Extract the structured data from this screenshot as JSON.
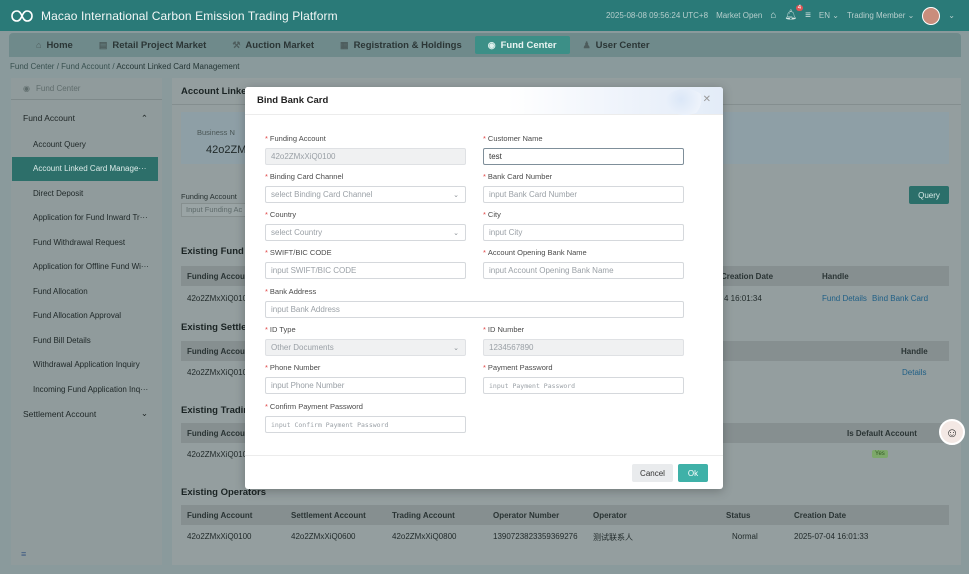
{
  "header": {
    "app_title": "Macao International Carbon Emission Trading Platform",
    "datetime": "2025-08-08 09:56:24 UTC+8",
    "market_status": "Market Open",
    "notif_count": "4",
    "language": "EN",
    "member_type": "Trading Member"
  },
  "nav": {
    "tabs": [
      {
        "label": "Home"
      },
      {
        "label": "Retail Project Market"
      },
      {
        "label": "Auction Market"
      },
      {
        "label": "Registration & Holdings"
      },
      {
        "label": "Fund Center"
      },
      {
        "label": "User Center"
      }
    ]
  },
  "breadcrumb": {
    "items": [
      "Fund Center",
      "Fund Account",
      "Account Linked Card Management"
    ],
    "sep": "/"
  },
  "sidebar": {
    "header": "Fund Center",
    "group_fund": "Fund Account",
    "items": [
      "Account Query",
      "Account Linked Card Manage···",
      "Direct Deposit",
      "Application for Fund Inward Tr···",
      "Fund Withdrawal Request",
      "Application for Offline Fund Wi···",
      "Fund Allocation",
      "Fund Allocation Approval",
      "Fund Bill Details",
      "Withdrawal Application Inquiry",
      "Incoming Fund Application Inq···"
    ],
    "group_settlement": "Settlement Account",
    "footer_icon": "≡"
  },
  "main": {
    "title": "Account Linked",
    "biz_label": "Business N",
    "biz_value": "42o2ZMx",
    "fa_label": "Funding Account",
    "fa_placeholder": "Input Funding Ac",
    "query_label": "Query",
    "sec_fund": "Existing Fund A",
    "fund_table": {
      "h_account": "Funding Accoun",
      "h_date": "Creation Date",
      "h_handle": "Handle",
      "r_account": "42o2ZMxXiQ010",
      "r_date": "4 16:01:34",
      "r_link1": "Fund Details",
      "r_link2": "Bind Bank Card"
    },
    "sec_settle": "Existing Settler",
    "settle_table": {
      "h_account": "Funding Accoun",
      "h_handle": "Handle",
      "r_account": "42o2ZMxXiQ010",
      "r_link": "Details"
    },
    "sec_trading": "Existing Trading",
    "trading_table": {
      "h_account": "Funding Accoun",
      "h_default": "Is Default Account",
      "r_account": "42o2ZMxXiQ010",
      "r_yes": "Yes"
    },
    "sec_ops": "Existing Operators",
    "ops_table": {
      "headers": [
        "Funding Account",
        "Settlement Account",
        "Trading Account",
        "Operator Number",
        "Operator",
        "Status",
        "Creation Date"
      ],
      "row": [
        "42o2ZMxXiQ0100",
        "42o2ZMxXiQ0600",
        "42o2ZMxXiQ0800",
        "1390723823359369276",
        "测试联系人",
        "Normal",
        "2025-07-04 16:01:33"
      ]
    }
  },
  "modal": {
    "title": "Bind Bank Card",
    "fields": {
      "funding_account": {
        "label": "Funding Account",
        "value": "42o2ZMxXiQ0100"
      },
      "customer_name": {
        "label": "Customer Name",
        "value": "test"
      },
      "binding_channel": {
        "label": "Binding Card Channel",
        "placeholder": "select Binding Card Channel"
      },
      "bank_card_number": {
        "label": "Bank Card Number",
        "placeholder": "input Bank Card Number"
      },
      "country": {
        "label": "Country",
        "placeholder": "select Country"
      },
      "city": {
        "label": "City",
        "placeholder": "input City"
      },
      "swift": {
        "label": "SWIFT/BIC CODE",
        "placeholder": "input SWIFT/BIC CODE"
      },
      "opening_bank": {
        "label": "Account Opening Bank Name",
        "placeholder": "input Account Opening Bank Name"
      },
      "bank_address": {
        "label": "Bank Address",
        "placeholder": "input Bank Address"
      },
      "id_type": {
        "label": "ID Type",
        "value": "Other Documents"
      },
      "id_number": {
        "label": "ID Number",
        "value": "1234567890"
      },
      "phone": {
        "label": "Phone Number",
        "placeholder": "input Phone Number"
      },
      "payment_password": {
        "label": "Payment Password",
        "placeholder": "input Payment Password"
      },
      "confirm_password": {
        "label": "Confirm Payment Password",
        "placeholder": "input Confirm Payment Password"
      }
    },
    "required_mark": "*",
    "cancel_label": "Cancel",
    "ok_label": "Ok"
  }
}
